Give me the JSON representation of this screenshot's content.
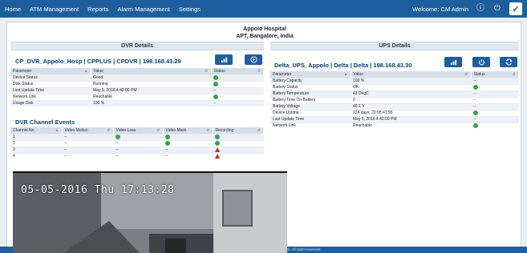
{
  "nav": {
    "items": [
      "Home",
      "ATM Management",
      "Reports",
      "Alarm Management",
      "Settings"
    ],
    "welcome": "Welcome: CM Admin"
  },
  "hospital": {
    "name": "Appolo Hospital",
    "address": "APT, Bangalore, India"
  },
  "dvr": {
    "section_title": "DVR Details",
    "device_title": "CP_DVR_Appolo_Hosp | CPPLUS | CPDVR | 198.168.43.29",
    "columns": [
      "Parameter",
      "Value",
      "Status"
    ],
    "rows": [
      {
        "param": "Device Status",
        "value": "Good",
        "status": "ok"
      },
      {
        "param": "Disk Status",
        "value": "Running",
        "status": "ok"
      },
      {
        "param": "Last Update Time",
        "value": "May 5, 2016 4:42:00 PM",
        "status": "--"
      },
      {
        "param": "Network Link",
        "value": "Reachable",
        "status": "ok"
      },
      {
        "param": "Usage Disk",
        "value": "100  %",
        "status": "--"
      }
    ],
    "channels_title": "DVR Channel Events",
    "channel_columns": [
      "Channel No.",
      "Video Motion",
      "Video Loss",
      "Video Mask",
      "Recording"
    ],
    "channels": [
      {
        "no": "1",
        "motion": "--",
        "loss": "ok",
        "mask": "ok",
        "recording": "ok"
      },
      {
        "no": "2",
        "motion": "--",
        "loss": "--",
        "mask": "ok",
        "recording": "ok"
      },
      {
        "no": "3",
        "motion": "--",
        "loss": "--",
        "mask": "--",
        "recording": "warn"
      },
      {
        "no": "4",
        "motion": "--",
        "loss": "--",
        "mask": "--",
        "recording": "warn"
      }
    ]
  },
  "ups": {
    "section_title": "UPS Details",
    "device_title": "Delta_UPS_Appolo | Delta | Delta | 198.168.43.30",
    "columns": [
      "Parameter",
      "Value",
      "Status"
    ],
    "rows": [
      {
        "param": "Battery Capacity",
        "value": "100  %",
        "status": "--"
      },
      {
        "param": "Battery Status",
        "value": "OK",
        "status": "ok"
      },
      {
        "param": "Battery Temperature",
        "value": "43  DegC",
        "status": "--"
      },
      {
        "param": "Battery Time On Battery",
        "value": "0",
        "status": "--"
      },
      {
        "param": "Battery Voltage",
        "value": "40.1  V",
        "status": "--"
      },
      {
        "param": "Device Uptime",
        "value": "224 days, 22:05:41.95",
        "status": "ok"
      },
      {
        "param": "Last Update Time",
        "value": "May 5, 2016 4:42:00 PM",
        "status": "--"
      },
      {
        "param": "Network Link",
        "value": "Reachable",
        "status": "ok"
      }
    ]
  },
  "cctv": {
    "timestamp": "05-05-2016 Thu 17:13:28"
  },
  "footer": {
    "text": "Ltd. All rights reserved."
  },
  "colors": {
    "nav": "#1d5f9c",
    "ok": "#34a24a",
    "warn": "#d8211c",
    "button": "#1c5f9e"
  }
}
